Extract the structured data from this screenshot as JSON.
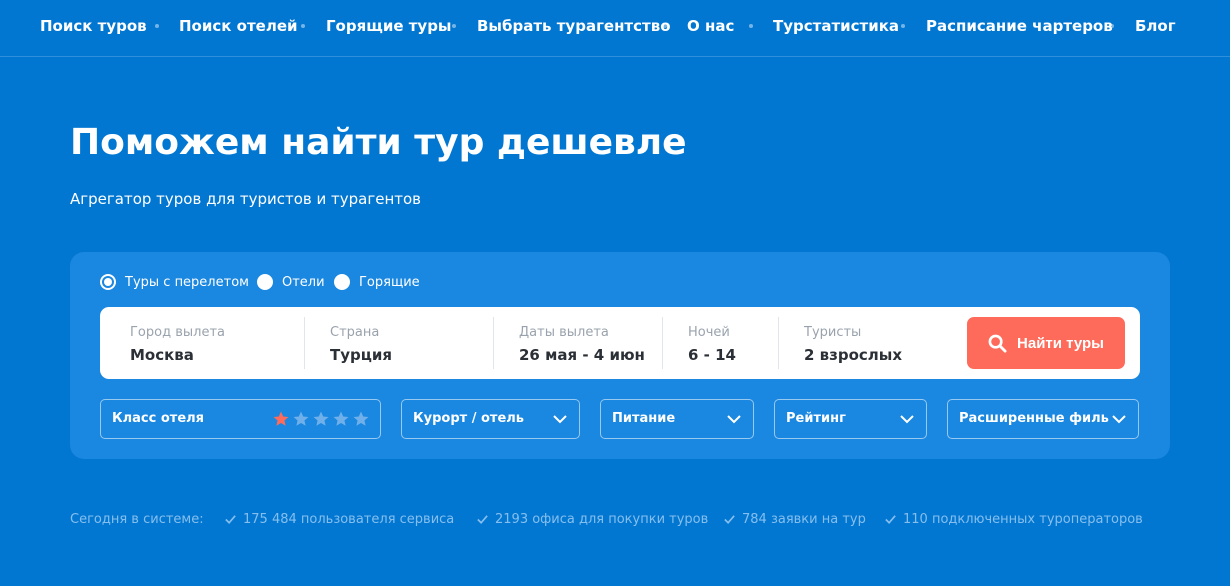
{
  "nav": {
    "items": [
      {
        "label": "Поиск туров"
      },
      {
        "label": "Поиск отелей"
      },
      {
        "label": "Горящие туры"
      },
      {
        "label": "Выбрать турагентство"
      },
      {
        "label": "О нас"
      },
      {
        "label": "Турстатистика"
      },
      {
        "label": "Расписание чартеров"
      },
      {
        "label": "Блог"
      }
    ]
  },
  "hero": {
    "title": "Поможем найти тур дешевле",
    "subtitle": "Агрегатор туров для туристов и турагентов"
  },
  "search": {
    "modes": [
      {
        "label": "Туры с перелетом",
        "selected": true
      },
      {
        "label": "Отели",
        "selected": false
      },
      {
        "label": "Горящие",
        "selected": false
      }
    ],
    "fields": [
      {
        "label": "Город вылета",
        "value": "Москва"
      },
      {
        "label": "Страна",
        "value": "Турция"
      },
      {
        "label": "Даты вылета",
        "value": "26 мая - 4 июн"
      },
      {
        "label": "Ночей",
        "value": "6 - 14"
      },
      {
        "label": "Туристы",
        "value": "2 взрослых"
      }
    ],
    "submit_label": "Найти туры",
    "button_color": "#ff6b5b"
  },
  "filters": {
    "hotel_class": {
      "label": "Класс отеля",
      "selected_stars": 1,
      "total_stars": 5
    },
    "resort": {
      "label": "Курорт / отель"
    },
    "meal": {
      "label": "Питание"
    },
    "rating": {
      "label": "Рейтинг"
    },
    "advanced": {
      "label": "Расширенные филь..."
    }
  },
  "stats": {
    "label": "Сегодня в системе:",
    "items": [
      {
        "text": "175 484 пользователя сервиса"
      },
      {
        "text": "2193 офиса для покупки туров"
      },
      {
        "text": "784 заявки на тур"
      },
      {
        "text": "110 подключенных туроператоров"
      }
    ]
  },
  "colors": {
    "background": "#0277d2",
    "panel": "#1a87e0",
    "accent": "#ff6b5b",
    "star_active": "#ff6b5b",
    "star_inactive": "#6fb0ea"
  }
}
